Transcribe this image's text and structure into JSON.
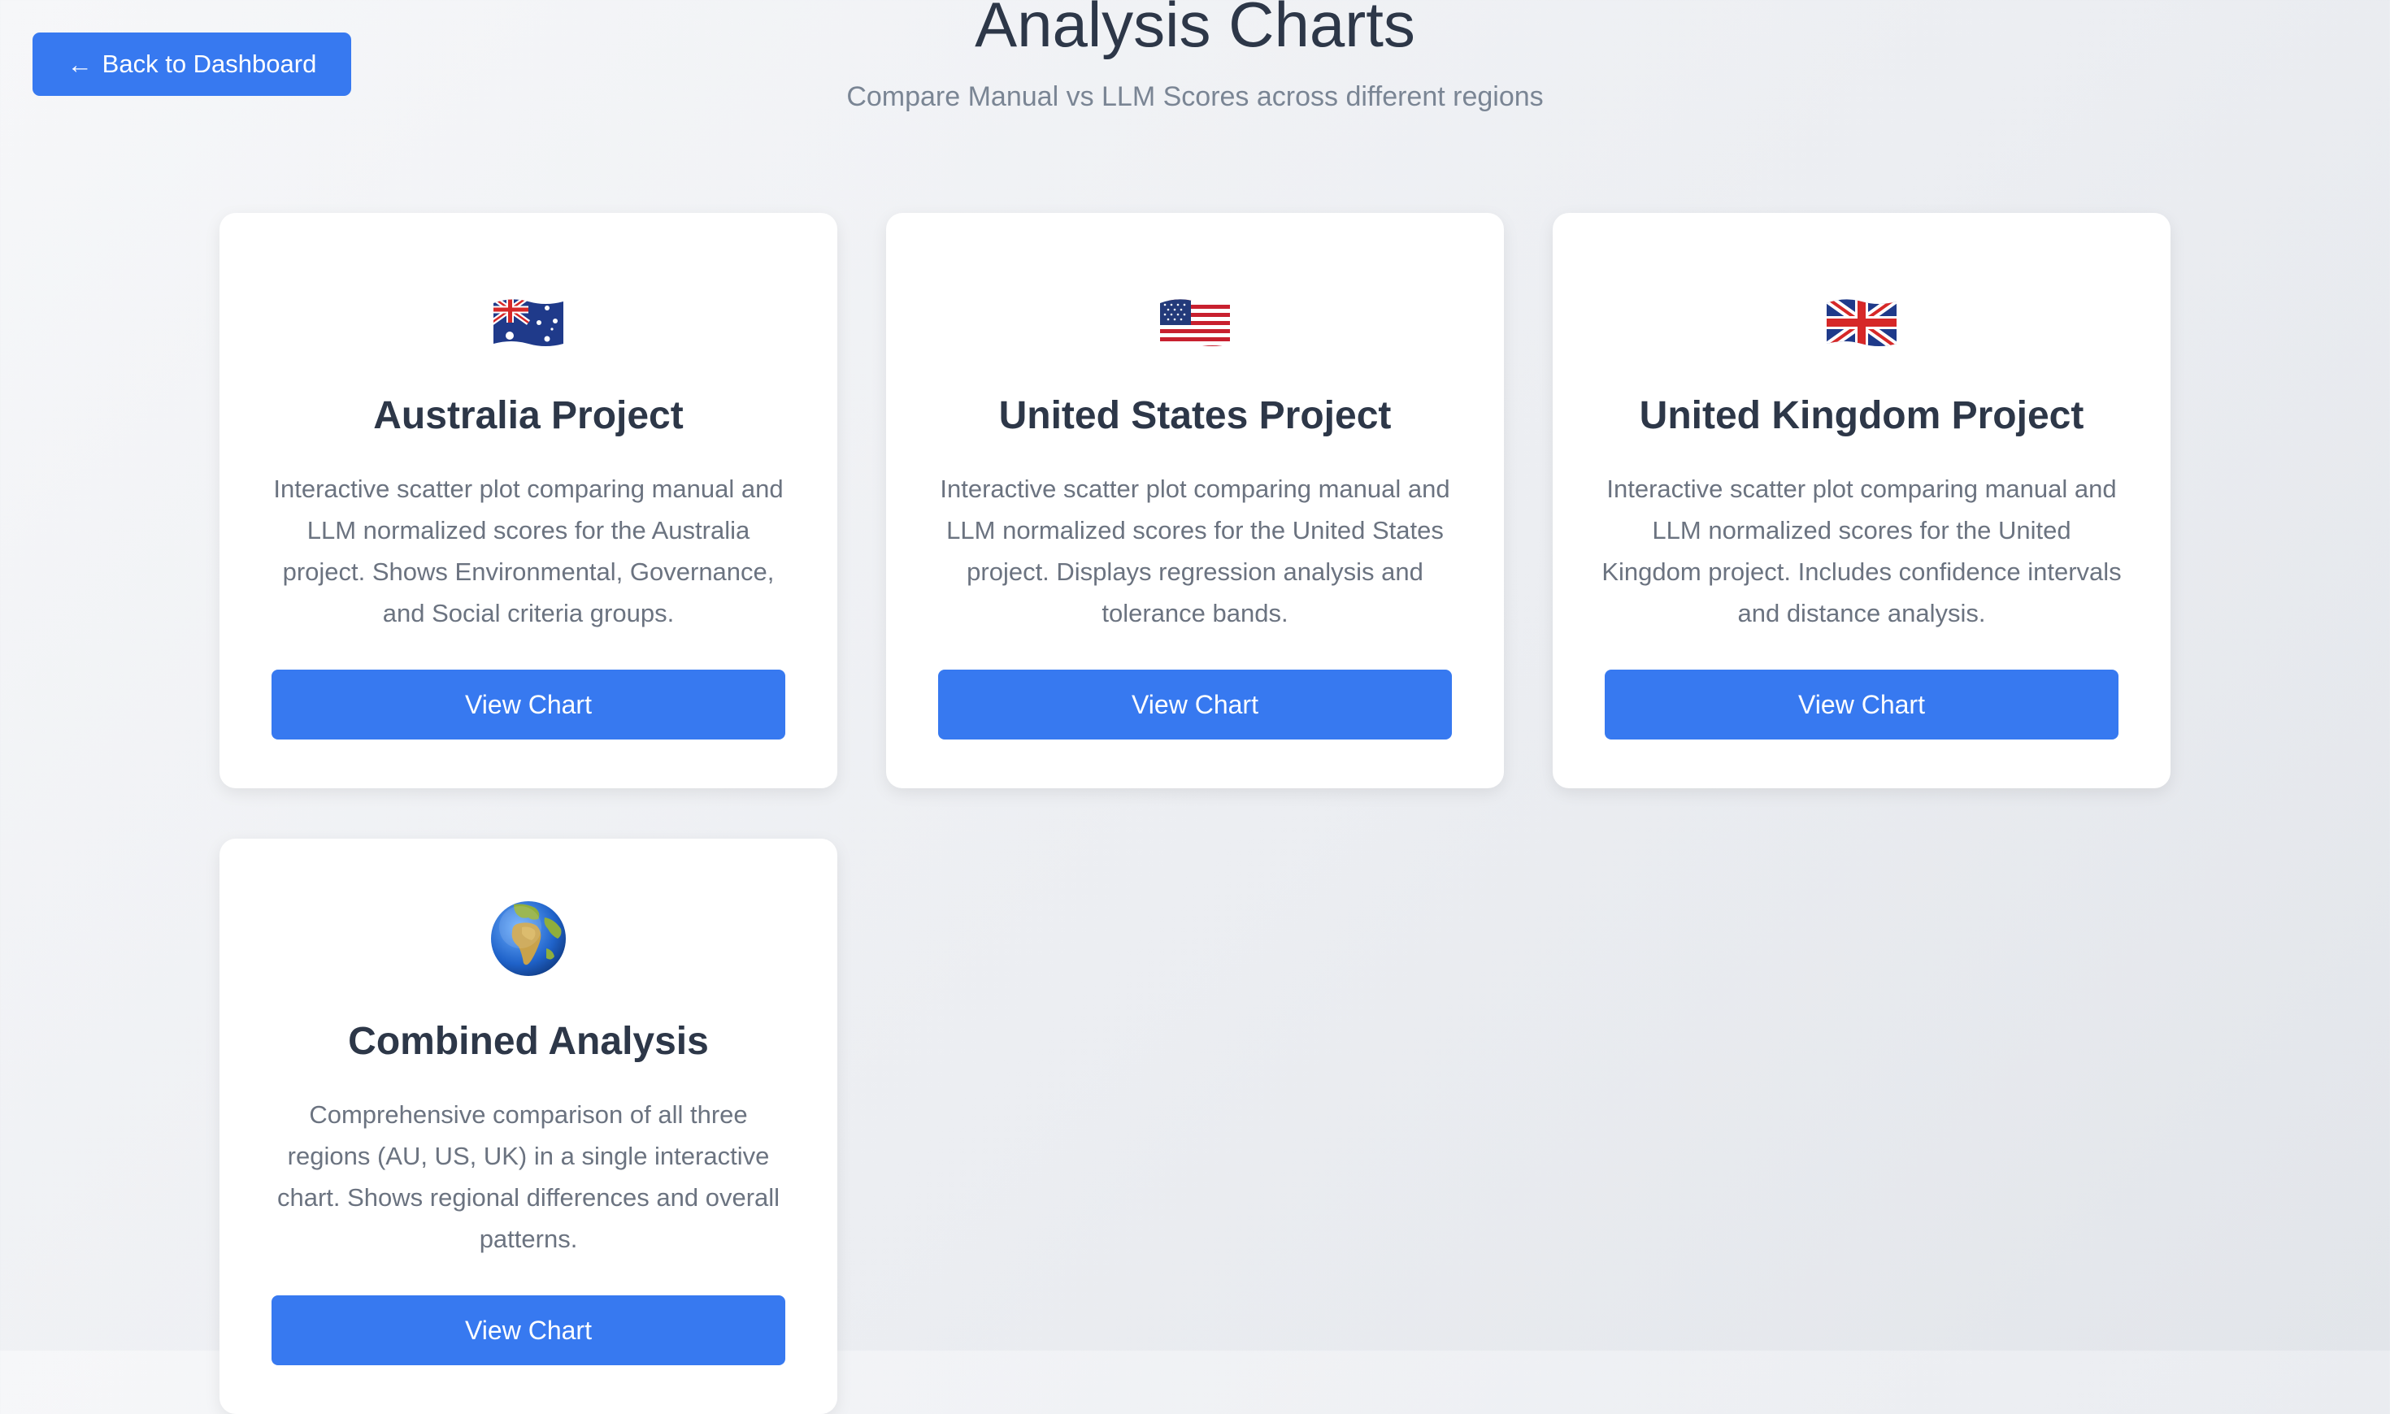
{
  "header": {
    "back_label": "Back to Dashboard",
    "title": "Analysis Charts",
    "subtitle": "Compare Manual vs LLM Scores across different regions"
  },
  "cards": [
    {
      "icon": "australia-flag-icon",
      "title": "Australia Project",
      "description": "Interactive scatter plot comparing manual and LLM normalized scores for the Australia project. Shows Environmental, Governance, and Social criteria groups.",
      "button_label": "View Chart"
    },
    {
      "icon": "us-flag-icon",
      "title": "United States Project",
      "description": "Interactive scatter plot comparing manual and LLM normalized scores for the United States project. Displays regression analysis and tolerance bands.",
      "button_label": "View Chart"
    },
    {
      "icon": "uk-flag-icon",
      "title": "United Kingdom Project",
      "description": "Interactive scatter plot comparing manual and LLM normalized scores for the United Kingdom project. Includes confidence intervals and distance analysis.",
      "button_label": "View Chart"
    },
    {
      "icon": "globe-icon",
      "title": "Combined Analysis",
      "description": "Comprehensive comparison of all three regions (AU, US, UK) in a single interactive chart. Shows regional differences and overall patterns.",
      "button_label": "View Chart"
    }
  ],
  "colors": {
    "accent": "#3779f0",
    "title": "#2d3748",
    "muted": "#6b7380"
  }
}
